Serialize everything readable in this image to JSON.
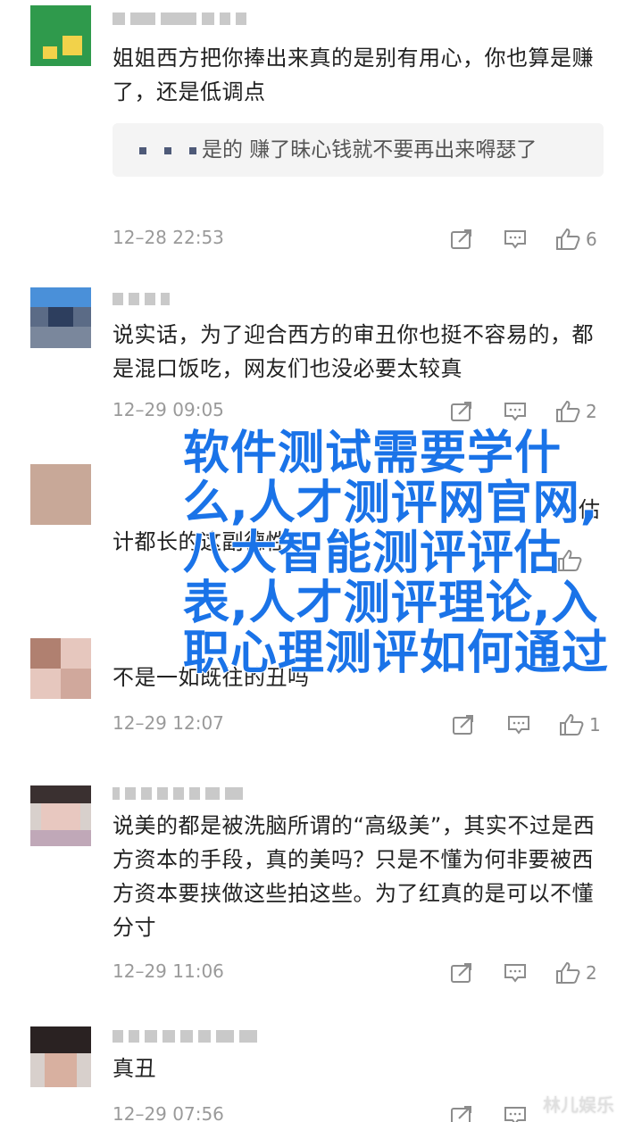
{
  "comments": [
    {
      "text": "姐姐西方把你捧出来真的是别有用心，你也算是赚了，还是低调点",
      "quote": "是的 赚了昧心钱就不要再出来嘚瑟了",
      "time": "12–28 22:53",
      "likes": "6"
    },
    {
      "text": "说实话，为了迎合西方的审丑你也挺不容易的，都是混口饭吃，网友们也没必要太较真",
      "time": "12–29 09:05",
      "likes": "2"
    },
    {
      "text_right": "估",
      "text_line2": "计都长的这副德性",
      "time": "",
      "likes": ""
    },
    {
      "text": "不是一如既往的丑吗",
      "time": "12–29 12:07",
      "likes": "1"
    },
    {
      "text": "说美的都是被洗脑所谓的“高级美”，其实不过是西方资本的手段，真的美吗？只是不懂为何非要被西方资本要挟做这些拍这些。为了红真的是可以不懂分寸",
      "time": "12–29 11:06",
      "likes": "2"
    },
    {
      "text": "真丑",
      "time": "12–29 07:56",
      "likes": ""
    }
  ],
  "overlay_title": "软件测试需要学什么,人才测评网官网,八大智能测评评估表,人才测评理论,入职心理测评如何通过",
  "watermark": "林儿娱乐",
  "icons": {
    "share": "share-icon",
    "reply": "reply-icon",
    "like": "thumbs-up-icon"
  },
  "colors": {
    "overlay": "#1a73e8",
    "meta": "#9a9a9a"
  }
}
